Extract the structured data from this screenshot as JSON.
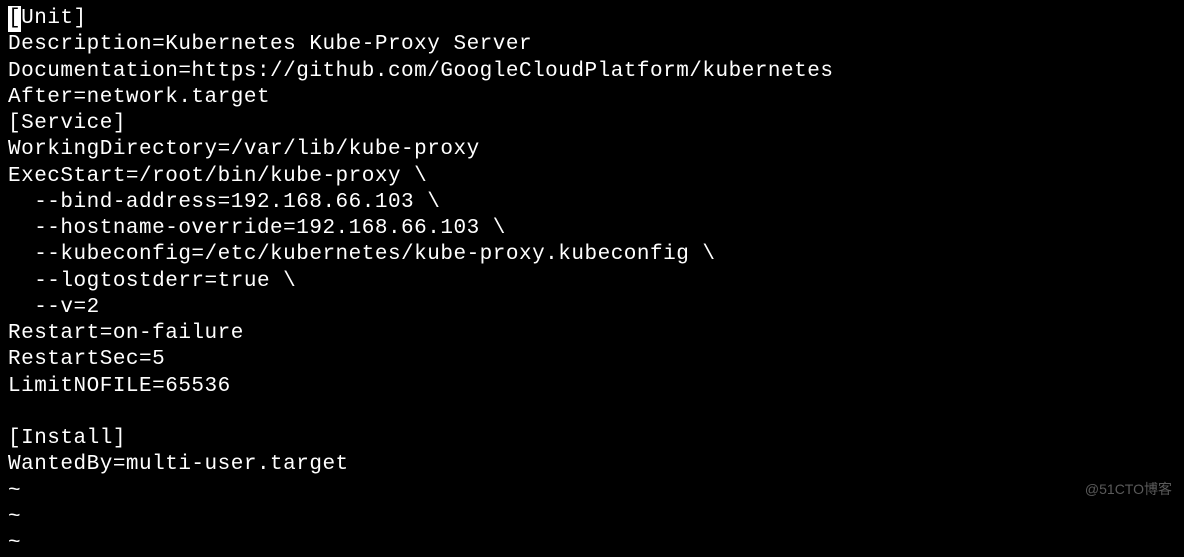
{
  "terminal": {
    "lines": [
      {
        "type": "cursor-line",
        "cursor": "[",
        "rest": "Unit]"
      },
      {
        "type": "text",
        "content": "Description=Kubernetes Kube-Proxy Server"
      },
      {
        "type": "text",
        "content": "Documentation=https://github.com/GoogleCloudPlatform/kubernetes"
      },
      {
        "type": "text",
        "content": "After=network.target"
      },
      {
        "type": "text",
        "content": "[Service]"
      },
      {
        "type": "text",
        "content": "WorkingDirectory=/var/lib/kube-proxy"
      },
      {
        "type": "text",
        "content": "ExecStart=/root/bin/kube-proxy \\"
      },
      {
        "type": "text",
        "content": "  --bind-address=192.168.66.103 \\"
      },
      {
        "type": "text",
        "content": "  --hostname-override=192.168.66.103 \\"
      },
      {
        "type": "text",
        "content": "  --kubeconfig=/etc/kubernetes/kube-proxy.kubeconfig \\"
      },
      {
        "type": "text",
        "content": "  --logtostderr=true \\"
      },
      {
        "type": "text",
        "content": "  --v=2"
      },
      {
        "type": "text",
        "content": "Restart=on-failure"
      },
      {
        "type": "text",
        "content": "RestartSec=5"
      },
      {
        "type": "text",
        "content": "LimitNOFILE=65536"
      },
      {
        "type": "text",
        "content": ""
      },
      {
        "type": "text",
        "content": "[Install]"
      },
      {
        "type": "text",
        "content": "WantedBy=multi-user.target"
      },
      {
        "type": "tilde",
        "content": "~"
      },
      {
        "type": "tilde",
        "content": "~"
      },
      {
        "type": "tilde",
        "content": "~"
      }
    ]
  },
  "watermark": "@51CTO博客"
}
